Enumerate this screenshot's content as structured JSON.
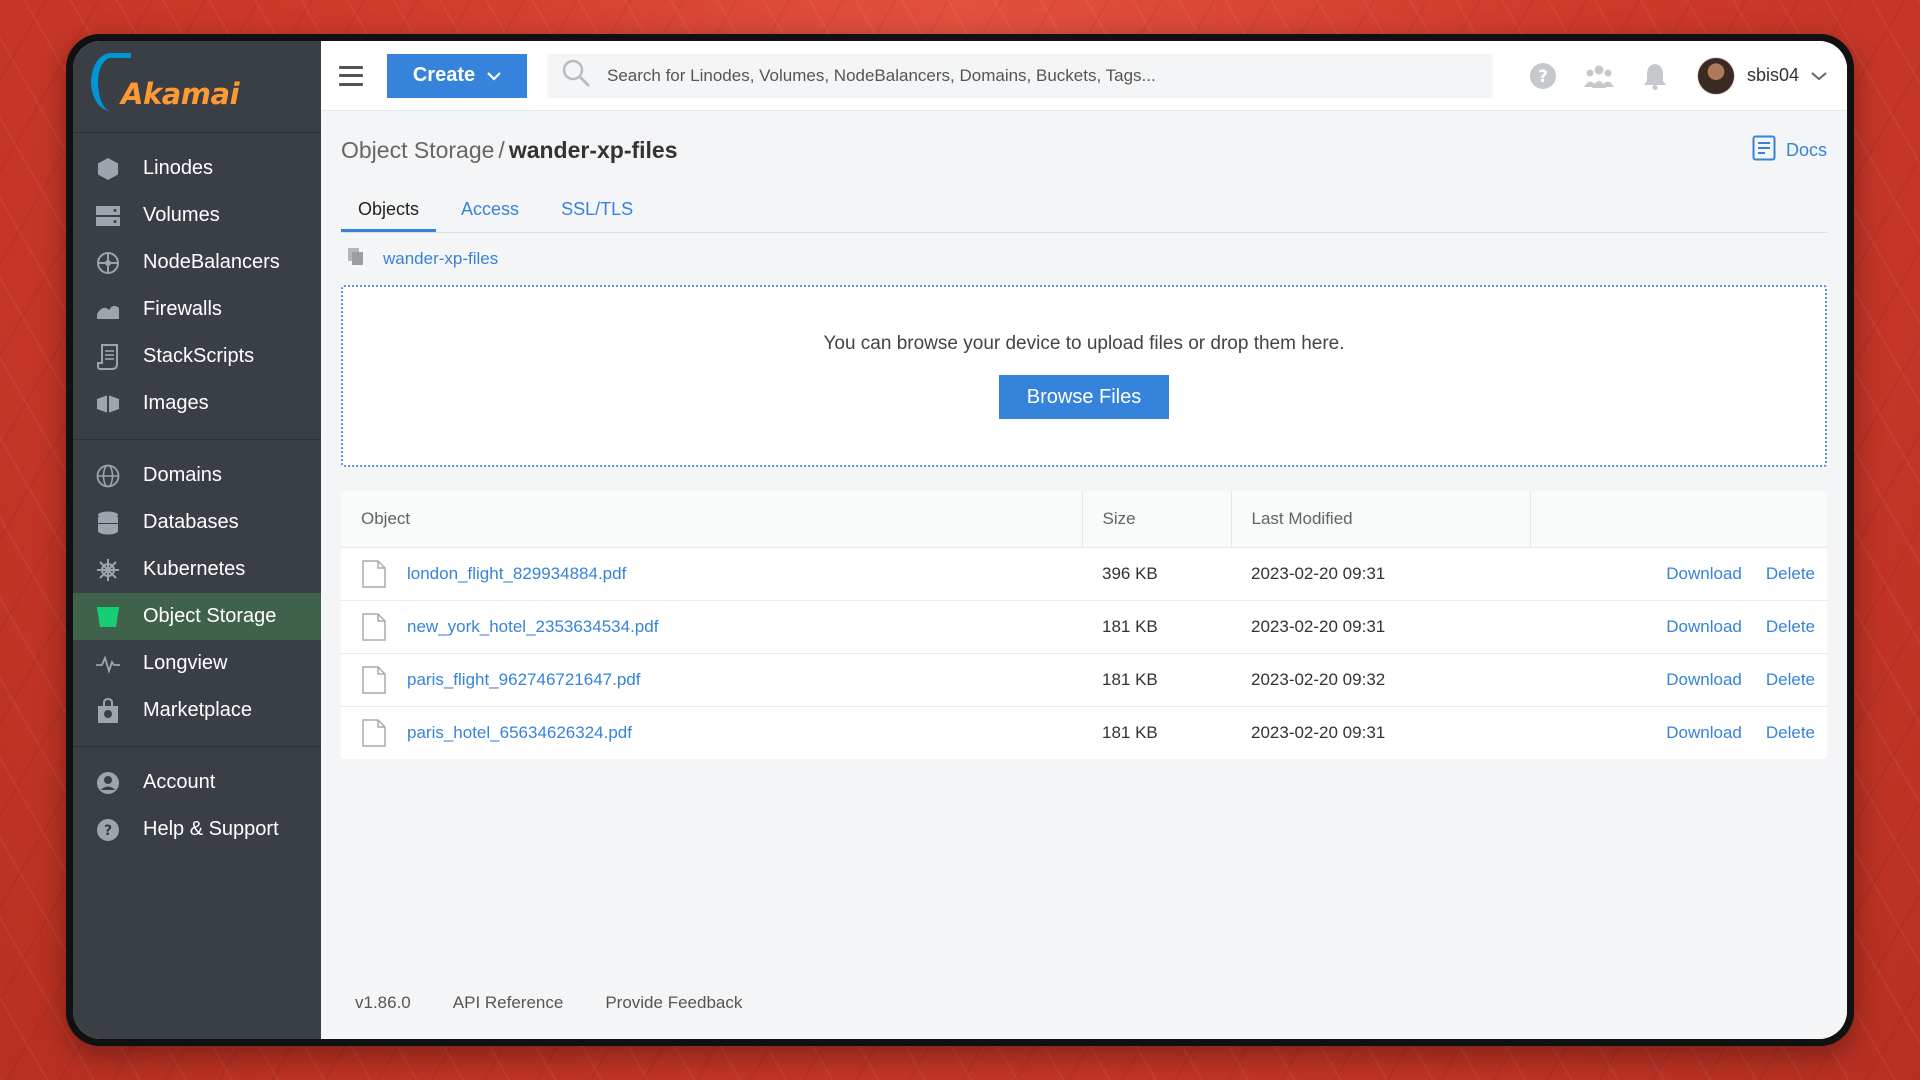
{
  "brand": {
    "logo_text": "Akamai"
  },
  "sidebar": {
    "groups": [
      [
        {
          "label": "Linodes",
          "icon": "hexagon-icon"
        },
        {
          "label": "Volumes",
          "icon": "volume-icon"
        },
        {
          "label": "NodeBalancers",
          "icon": "nodebalancer-icon"
        },
        {
          "label": "Firewalls",
          "icon": "firewall-icon"
        },
        {
          "label": "StackScripts",
          "icon": "script-icon"
        },
        {
          "label": "Images",
          "icon": "image-icon"
        }
      ],
      [
        {
          "label": "Domains",
          "icon": "globe-icon"
        },
        {
          "label": "Databases",
          "icon": "database-icon"
        },
        {
          "label": "Kubernetes",
          "icon": "helm-icon"
        },
        {
          "label": "Object Storage",
          "icon": "bucket-icon",
          "active": true
        },
        {
          "label": "Longview",
          "icon": "pulse-icon"
        },
        {
          "label": "Marketplace",
          "icon": "bag-icon"
        }
      ],
      [
        {
          "label": "Account",
          "icon": "user-icon"
        },
        {
          "label": "Help & Support",
          "icon": "help-icon"
        }
      ]
    ],
    "active_color": "#17cf73"
  },
  "topbar": {
    "create_label": "Create",
    "search_placeholder": "Search for Linodes, Volumes, NodeBalancers, Domains, Buckets, Tags...",
    "username": "sbis04"
  },
  "page": {
    "breadcrumb_parent": "Object Storage",
    "breadcrumb_sep": "/",
    "breadcrumb_current": "wander-xp-files",
    "docs_label": "Docs",
    "tabs": [
      "Objects",
      "Access",
      "SSL/TLS"
    ],
    "bucket_name": "wander-xp-files",
    "dropzone_text": "You can browse your device to upload files or drop them here.",
    "browse_label": "Browse Files"
  },
  "table": {
    "headers": [
      "Object",
      "Size",
      "Last Modified",
      ""
    ],
    "rows": [
      {
        "name": "london_flight_829934884.pdf",
        "size": "396 KB",
        "modified": "2023-02-20 09:31"
      },
      {
        "name": "new_york_hotel_2353634534.pdf",
        "size": "181 KB",
        "modified": "2023-02-20 09:31"
      },
      {
        "name": "paris_flight_962746721647.pdf",
        "size": "181 KB",
        "modified": "2023-02-20 09:32"
      },
      {
        "name": "paris_hotel_65634626324.pdf",
        "size": "181 KB",
        "modified": "2023-02-20 09:31"
      }
    ],
    "download_label": "Download",
    "delete_label": "Delete"
  },
  "footer": {
    "version": "v1.86.0",
    "api_reference": "API Reference",
    "feedback": "Provide Feedback"
  },
  "colors": {
    "accent": "#3683dc",
    "sidebar_bg": "#3a3f46",
    "background": "#cf3a2a"
  }
}
